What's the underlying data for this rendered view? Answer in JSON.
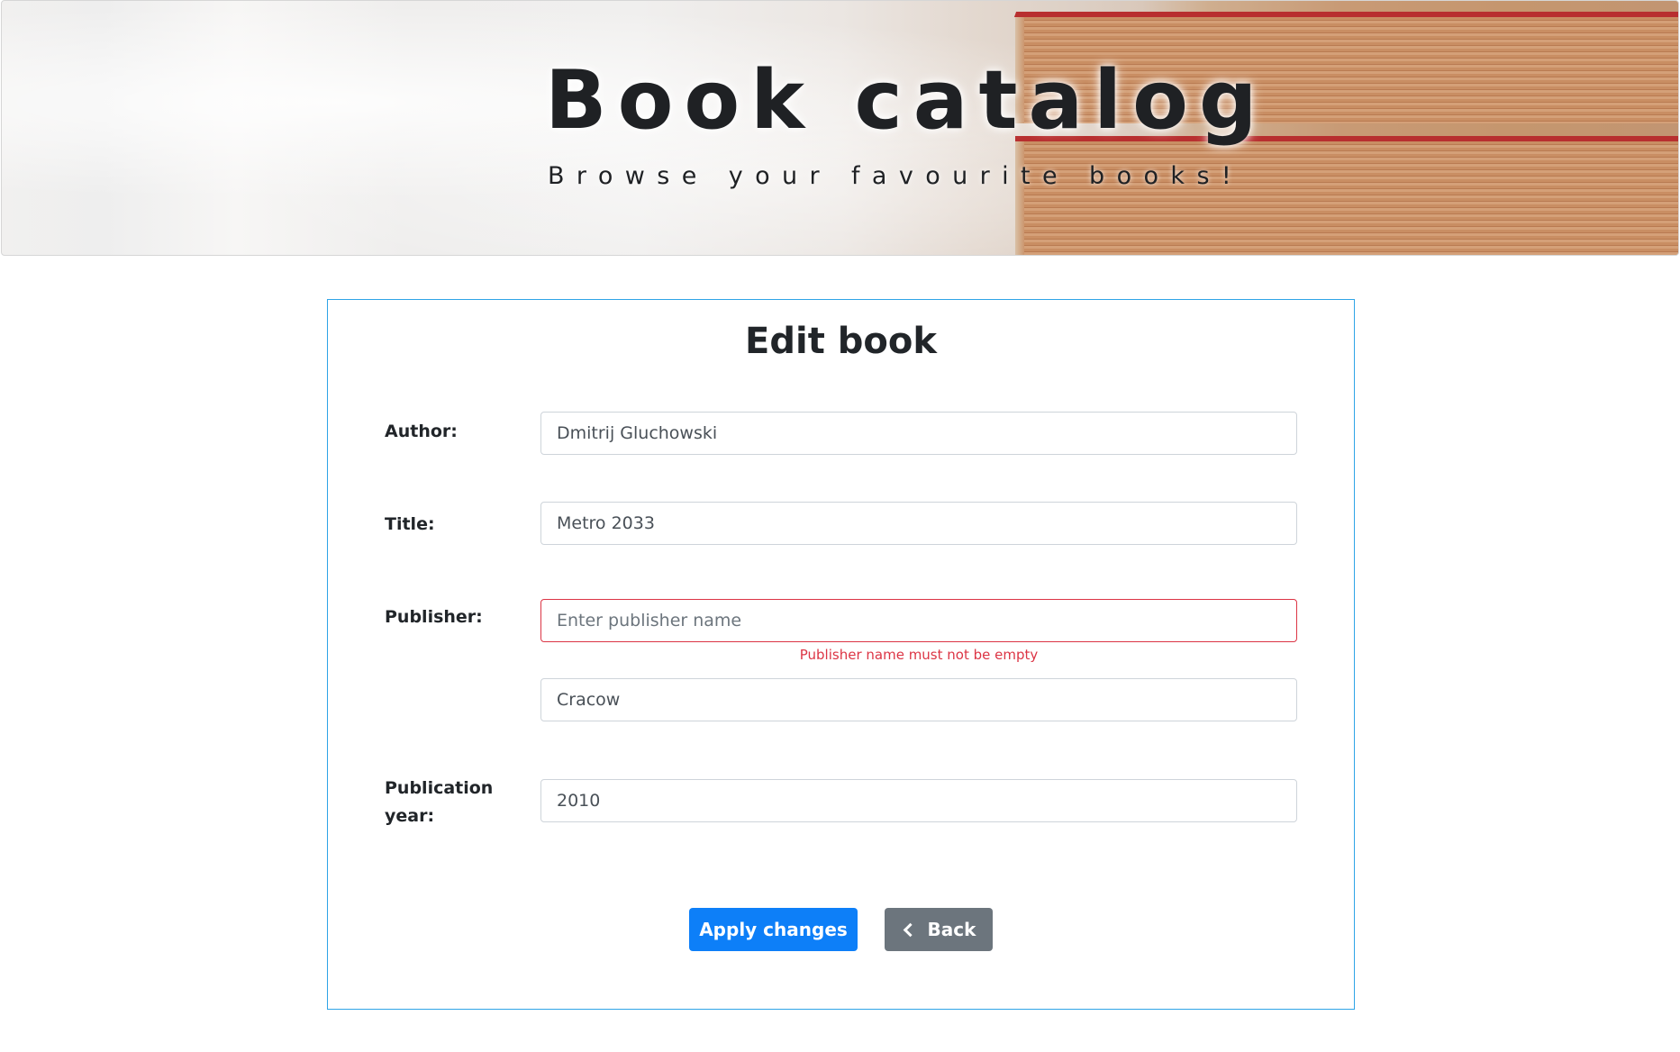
{
  "header": {
    "title": "Book catalog",
    "subtitle": "Browse your favourite books!"
  },
  "form": {
    "heading": "Edit book",
    "author": {
      "label": "Author:",
      "value": "Dmitrij Gluchowski"
    },
    "title": {
      "label": "Title:",
      "value": "Metro 2033"
    },
    "publisher": {
      "label": "Publisher:",
      "name_value": "",
      "name_placeholder": "Enter publisher name",
      "name_error": "Publisher name must not be empty",
      "city_value": "Cracow"
    },
    "publication_year": {
      "label": "Publication year:",
      "value": "2010"
    },
    "buttons": {
      "apply": "Apply changes",
      "back": "Back"
    }
  },
  "colors": {
    "accent": "#0d7ff8",
    "card_border": "#2fa4e7",
    "error": "#dc3545",
    "secondary": "#6c757d"
  }
}
